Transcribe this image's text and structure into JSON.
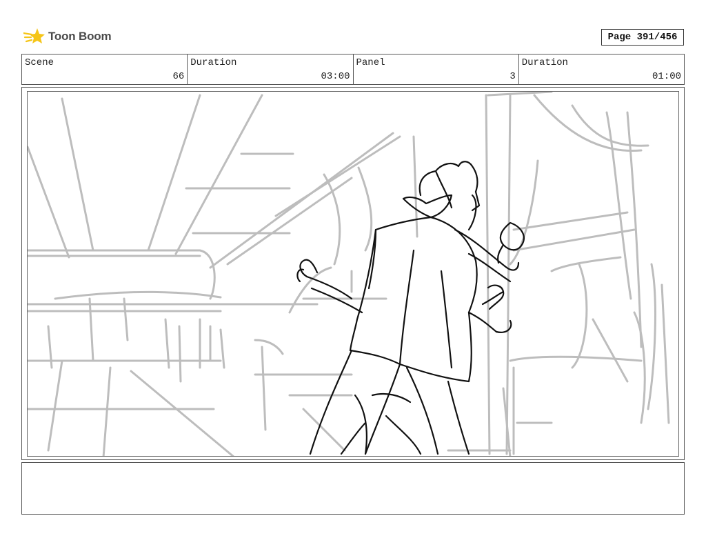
{
  "brand": {
    "logo_text": "Toon Boom",
    "accent": "#f5c518"
  },
  "page": {
    "label": "Page 391/456"
  },
  "header": {
    "scene_label": "Scene",
    "scene_value": "66",
    "scene_duration_label": "Duration",
    "scene_duration_value": "03:00",
    "panel_label": "Panel",
    "panel_value": "3",
    "panel_duration_label": "Duration",
    "panel_duration_value": "01:00"
  },
  "notes": {
    "text": ""
  }
}
